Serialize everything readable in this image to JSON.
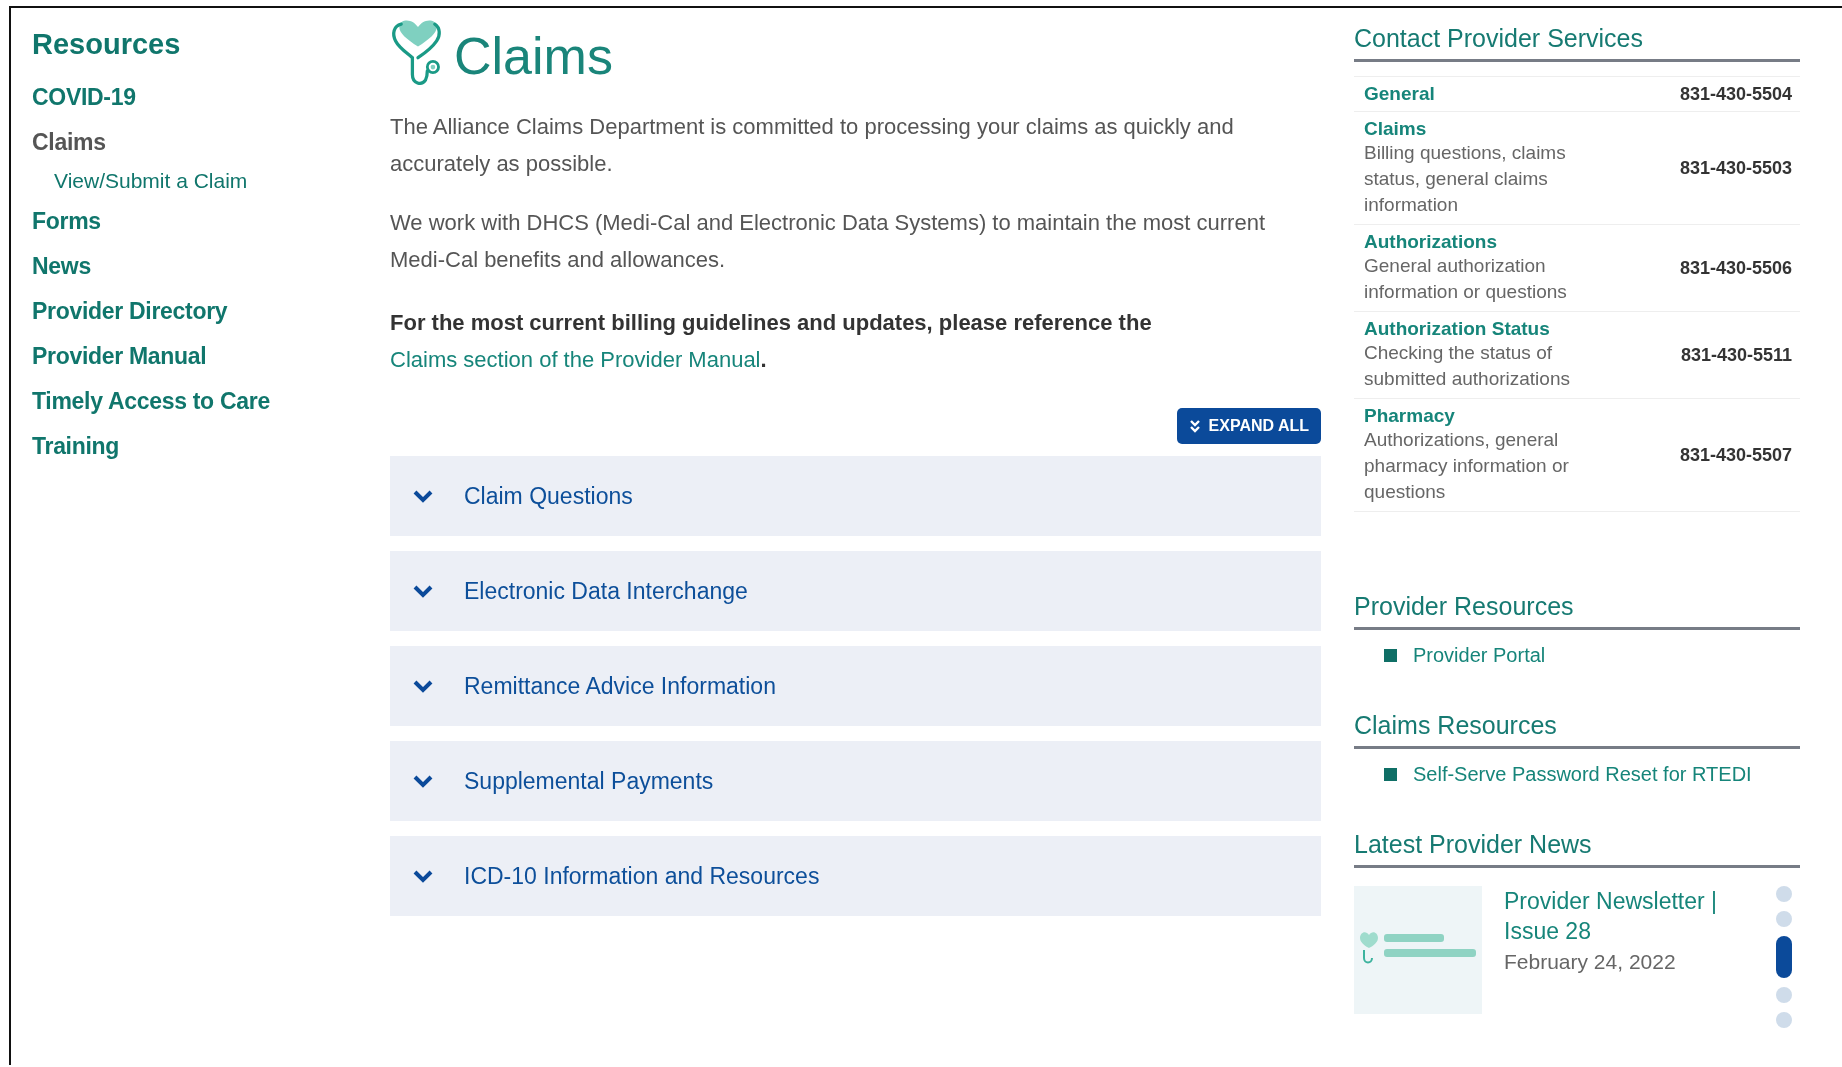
{
  "sidebar": {
    "title": "Resources",
    "items": [
      {
        "label": "COVID-19",
        "selected": false
      },
      {
        "label": "Claims",
        "selected": true,
        "children": [
          {
            "label": "View/Submit a Claim",
            "selected": false
          }
        ]
      },
      {
        "label": "Forms",
        "selected": false
      },
      {
        "label": "News",
        "selected": false
      },
      {
        "label": "Provider Directory",
        "selected": false
      },
      {
        "label": "Provider Manual",
        "selected": false
      },
      {
        "label": "Timely Access to Care",
        "selected": false
      },
      {
        "label": "Training",
        "selected": false
      }
    ]
  },
  "main": {
    "title": "Claims",
    "paragraphs": [
      "The Alliance Claims Department is committed to processing your claims as quickly and accurately as possible.",
      "We work with DHCS (Medi-Cal and Electronic Data Systems) to maintain the most current Medi-Cal benefits and allowances."
    ],
    "notice": {
      "text": "For the most current billing guidelines and updates, please reference the",
      "link": "Claims section of the Provider Manual",
      "after": "."
    },
    "expand_button": "EXPAND ALL",
    "accordion": [
      {
        "label": "Claim Questions",
        "expanded": false
      },
      {
        "label": "Electronic Data Interchange",
        "expanded": false
      },
      {
        "label": "Remittance Advice Information",
        "expanded": false
      },
      {
        "label": "Supplemental Payments",
        "expanded": false
      },
      {
        "label": "ICD-10 Information and Resources",
        "expanded": false
      }
    ]
  },
  "contact": {
    "title": "Contact Provider Services",
    "rows": [
      {
        "label": "General",
        "phone": "831-430-5504"
      },
      {
        "label": "Claims",
        "description": "Billing questions, claims status, general claims information",
        "phone": "831-430-5503"
      },
      {
        "label": "Authorizations",
        "description": "General authorization information or questions",
        "phone": "831-430-5506"
      },
      {
        "label": "Authorization Status",
        "description": "Checking the status of submitted authorizations",
        "phone": "831-430-5511"
      },
      {
        "label": "Pharmacy",
        "description": "Authorizations, general pharmacy information or questions",
        "phone": "831-430-5507"
      }
    ]
  },
  "resource_sections": [
    {
      "title": "Provider Resources",
      "links": [
        "Provider Portal"
      ]
    },
    {
      "title": "Claims Resources",
      "links": [
        "Self-Serve Password Reset for RTEDI"
      ]
    }
  ],
  "news": {
    "title": "Latest Provider News",
    "item": {
      "kind": "picture",
      "title": "Provider Newsletter | Issue 28",
      "date": "February 24, 2022"
    },
    "carousel_dots": [
      {
        "selected": false
      },
      {
        "selected": false
      },
      {
        "selected": true
      },
      {
        "selected": false
      },
      {
        "selected": false
      }
    ]
  }
}
